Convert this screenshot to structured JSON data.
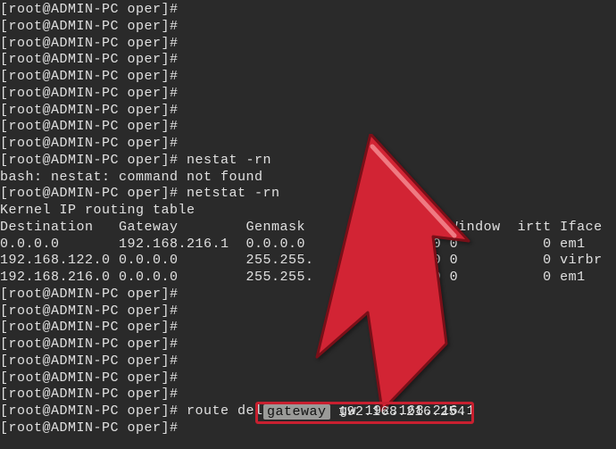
{
  "prompt": "[root@ADMIN-PC oper]# ",
  "cmds": {
    "nestat": "nestat -rn",
    "netstat": "netstat -rn",
    "routedel": "route del default gw 192.168.216.1"
  },
  "err": "bash: nestat: command not found",
  "rt_header": "Kernel IP routing table",
  "rt_cols": "Destination   Gateway        Genmask             MSS Window  irtt Iface",
  "rt_rows": [
    "0.0.0.0       192.168.216.1  0.0.0.0               0 0          0 em1",
    "192.168.122.0 0.0.0.0        255.255.              0 0          0 virbr",
    "192.168.216.0 0.0.0.0        255.255.              0 0          0 em1"
  ],
  "highlight": {
    "label": "gateway",
    "value": " 192.168.216.254"
  },
  "colors": {
    "arrow_fill": "#d22434",
    "arrow_stroke": "#7a0f18"
  }
}
